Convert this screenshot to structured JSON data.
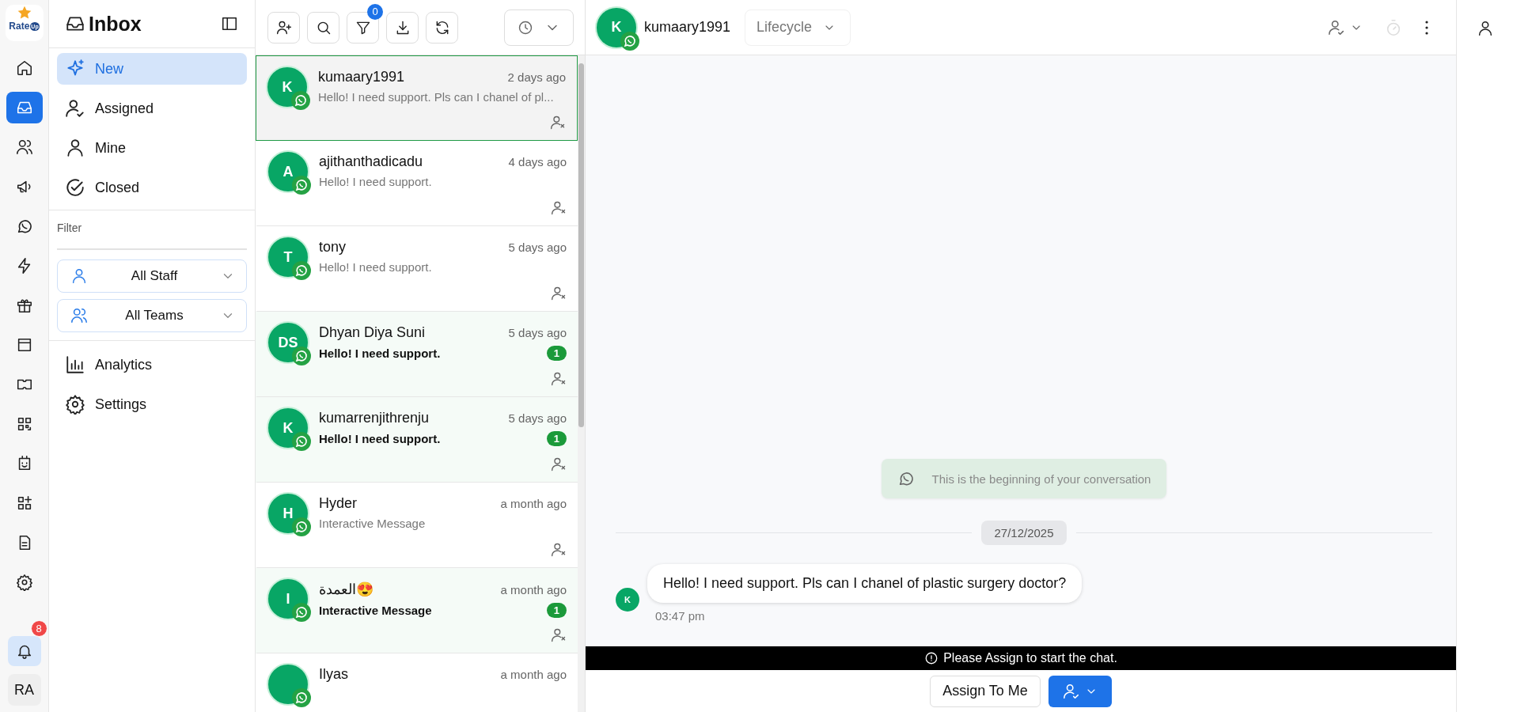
{
  "logo": {
    "text": "Rate",
    "badge": "Up"
  },
  "rail": {
    "items": [
      {
        "selected": false
      },
      {
        "selected": true
      },
      {
        "selected": false
      },
      {
        "selected": false
      },
      {
        "selected": false
      },
      {
        "selected": false
      },
      {
        "selected": false
      },
      {
        "selected": false
      },
      {
        "selected": false
      },
      {
        "selected": false
      },
      {
        "selected": false
      },
      {
        "selected": false
      },
      {
        "selected": false
      },
      {
        "selected": false
      }
    ],
    "notifications": "8",
    "user_initials": "RA"
  },
  "sidebar": {
    "title": "Inbox",
    "items": [
      {
        "label": "New",
        "selected": true
      },
      {
        "label": "Assigned",
        "selected": false
      },
      {
        "label": "Mine",
        "selected": false
      },
      {
        "label": "Closed",
        "selected": false
      }
    ],
    "filter_label": "Filter",
    "filters": [
      "All Staff",
      "All Teams"
    ],
    "bottom_items": [
      "Analytics",
      "Settings"
    ]
  },
  "toolbar": {
    "filter_count": "0"
  },
  "conversations": [
    {
      "initials": "K",
      "name": "kumaary1991",
      "time": "2 days ago",
      "preview": "Hello! I need support. Pls can I chanel of pl...",
      "unread": false,
      "selected": true
    },
    {
      "initials": "A",
      "name": "ajithanthadicadu",
      "time": "4 days ago",
      "preview": "Hello! I need support.",
      "unread": false,
      "selected": false
    },
    {
      "initials": "T",
      "name": "tony",
      "time": "5 days ago",
      "preview": "Hello! I need support.",
      "unread": false,
      "selected": false
    },
    {
      "initials": "DS",
      "name": "Dhyan Diya Suni",
      "time": "5 days ago",
      "preview": "Hello! I need support.",
      "unread": true,
      "count": "1",
      "selected": false
    },
    {
      "initials": "K",
      "name": "kumarrenjithrenju",
      "time": "5 days ago",
      "preview": "Hello! I need support.",
      "unread": true,
      "count": "1",
      "selected": false
    },
    {
      "initials": "H",
      "name": "Hyder",
      "time": "a month ago",
      "preview": "Interactive Message",
      "unread": false,
      "selected": false
    },
    {
      "initials": "I",
      "name": "العمدة😍",
      "time": "a month ago",
      "preview": "Interactive Message",
      "unread": true,
      "count": "1",
      "selected": false
    },
    {
      "name": "Ilyas",
      "time": "a month ago",
      "unread": false,
      "selected": false
    }
  ],
  "chat": {
    "contact": {
      "initials": "K",
      "name": "kumaary1991"
    },
    "lifecycle": "Lifecycle",
    "notice": "This is the beginning of your conversation",
    "date": "27/12/2025",
    "messages": [
      {
        "initials": "K",
        "text": "Hello! I need support. Pls can I chanel of plastic surgery doctor?",
        "time": "03:47 pm"
      }
    ],
    "alert": "Please Assign to start the chat.",
    "assign_button": "Assign To Me"
  }
}
